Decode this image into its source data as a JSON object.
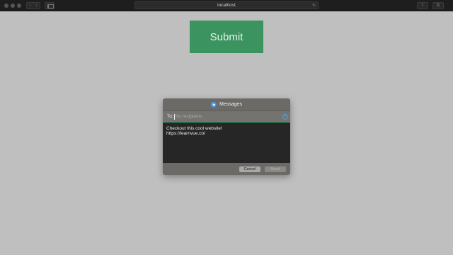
{
  "browser": {
    "address": "localhost",
    "nav_glyphs": {
      "back": "‹",
      "forward": "›"
    },
    "reload_glyph": "↻",
    "share_glyph": "⇧",
    "tabs_glyph": "⧉"
  },
  "page": {
    "submit_label": "Submit",
    "submit_color": "#3b9460"
  },
  "dialog": {
    "title": "Messages",
    "to_label": "To:",
    "to_placeholder": "No recipients",
    "add_glyph": "+",
    "message_body": "Checkout this cool website!\nhttps://learnvue.co/",
    "cancel_label": "Cancel",
    "send_label": "Send"
  }
}
